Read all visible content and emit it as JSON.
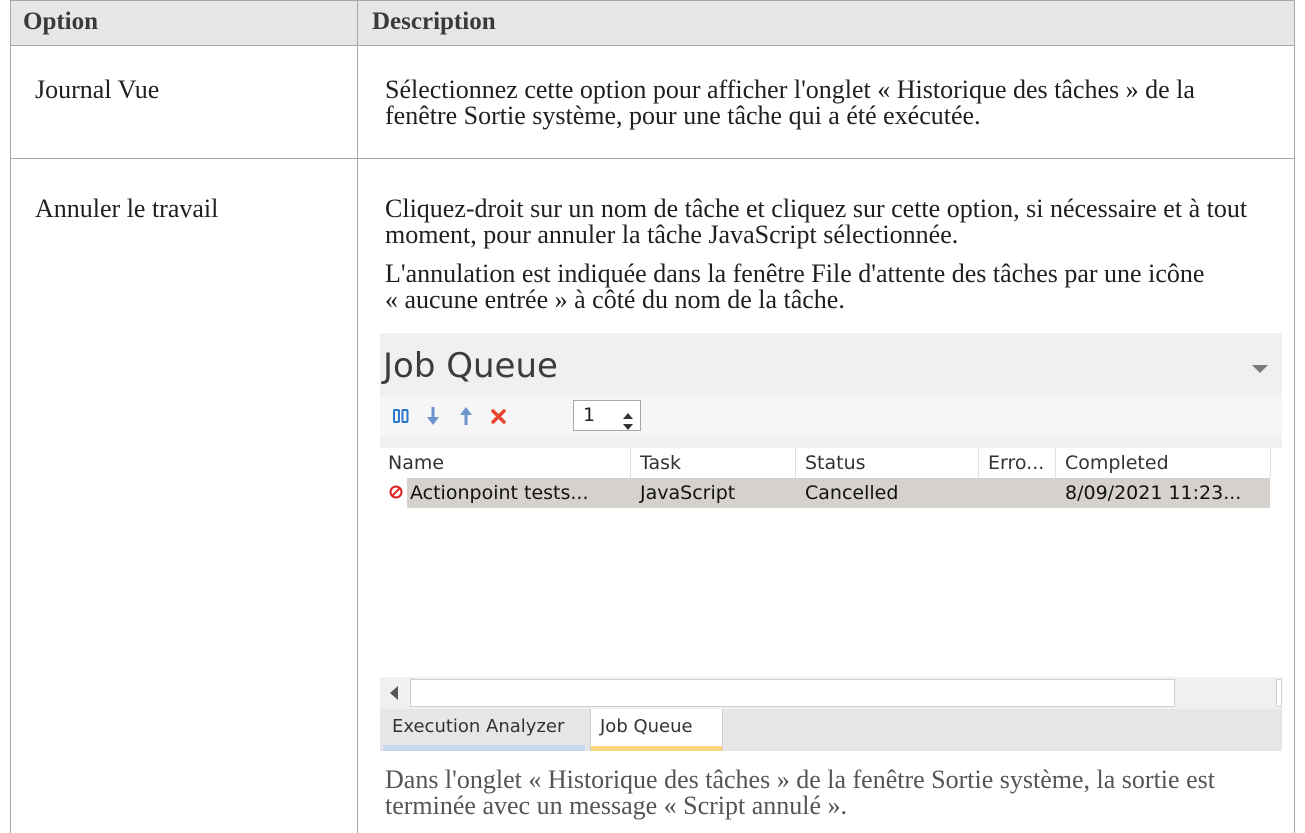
{
  "table": {
    "header": {
      "option": "Option",
      "description": "Description"
    },
    "rows": [
      {
        "option": "Journal Vue",
        "description": [
          "Sélectionnez cette option pour afficher l'onglet « Historique des tâches » de la",
          "fenêtre Sortie système, pour une tâche qui a été exécutée."
        ]
      },
      {
        "option": "Annuler le travail",
        "paragraph_1": [
          "Cliquez-droit sur un nom de tâche et cliquez sur cette option, si nécessaire et à tout",
          "moment, pour annuler la tâche JavaScript sélectionnée."
        ],
        "paragraph_2": [
          "L'annulation est indiquée dans la fenêtre File d'attente des tâches par une icône",
          "« aucune entrée » à côté du nom de la tâche."
        ],
        "paragraph_3": [
          "Dans l'onglet « Historique des tâches » de la fenêtre Sortie système, la sortie est",
          "terminée avec un message « Script annulé »."
        ]
      }
    ]
  },
  "screenshot": {
    "title": "Job Queue",
    "title_menu_icon": "dropdown-triangle-icon",
    "toolbar": {
      "icons": [
        "pause-icon",
        "move-down-icon",
        "move-up-icon",
        "cancel-icon"
      ],
      "spinner_value": "1"
    },
    "columns": [
      "Name",
      "Task",
      "Status",
      "Erro...",
      "Completed"
    ],
    "jobs": [
      {
        "status_icon": "no-entry-icon",
        "name": "Actionpoint tests...",
        "task": "JavaScript",
        "status": "Cancelled",
        "completed": "8/09/2021 11:23..."
      }
    ],
    "tabs": [
      {
        "label": "Execution Analyzer",
        "active": false
      },
      {
        "label": "Job Queue",
        "active": true
      }
    ]
  },
  "colors": {
    "header_background": "#e7e7e7",
    "table_border": "#a8a8a8",
    "selected_row": "#d5d1cc",
    "cancel_red": "#e5452c",
    "no_entry_red": "#e02424",
    "arrow_blue": "#6d93cf",
    "pause_blue": "#2b74cf",
    "tab_inactive_underline": "#c8d6ef",
    "tab_active_underline": "#fcd77f"
  }
}
